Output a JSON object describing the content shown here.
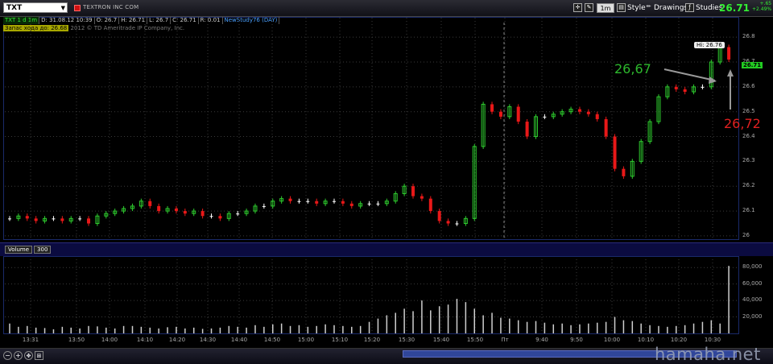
{
  "toolbar": {
    "symbol": "TXT",
    "company": "TEXTRON INC COM",
    "timeframe": "1m",
    "style_label": "Style",
    "drawings_label": "Drawings",
    "studies_label": "Studies",
    "last_price": "26.71",
    "change_line1": "+.65",
    "change_line2": "+2.49%"
  },
  "info": {
    "title": "TXT 1 d 1m",
    "date": "D: 31.08.12 10:39",
    "open": "O: 26.7",
    "high": "H: 26.71",
    "low": "L: 26.7",
    "close": "C: 26.71",
    "range": "R: 0.01",
    "study": "NewStudy76 (DAY)"
  },
  "study_line": {
    "label": "Запас хода до: 26.68",
    "copyright": "2012 © TD Ameritrade IP Company, Inc."
  },
  "hi_label": "Hi: 26.76",
  "last_badge": "26.71",
  "annotations": {
    "left_value": "26,67",
    "right_value": "26,72",
    "left_color": "#2db82d",
    "right_color": "#e02020"
  },
  "price_axis": [
    "26.8",
    "26.7",
    "26.6",
    "26.5",
    "26.4",
    "26.3",
    "26.2",
    "26.1",
    "26"
  ],
  "volume": {
    "label": "Volume",
    "period": "300",
    "axis": [
      "80,000",
      "60,000",
      "40,000",
      "20,000"
    ]
  },
  "time_axis": [
    "13:31",
    "13:50",
    "14:00",
    "14:10",
    "14:20",
    "14:30",
    "14:40",
    "14:50",
    "15:00",
    "15:10",
    "15:20",
    "15:30",
    "15:40",
    "15:50",
    "Пт",
    "9:40",
    "9:50",
    "10:00",
    "10:10",
    "10:20",
    "10:30"
  ],
  "watermark": "hamaha.net",
  "colors": {
    "up": "#2ecc2e",
    "down": "#e81818",
    "unchanged": "#ffffff",
    "grid": "#3a3a3a"
  },
  "chart_data": {
    "type": "candlestick",
    "ylim": [
      25.99,
      26.82
    ],
    "session_break_index": 40,
    "closes": [
      26.07,
      26.08,
      26.07,
      26.06,
      26.07,
      26.07,
      26.06,
      26.07,
      26.07,
      26.05,
      26.08,
      26.09,
      26.1,
      26.11,
      26.12,
      26.14,
      26.12,
      26.1,
      26.11,
      26.1,
      26.09,
      26.1,
      26.08,
      26.08,
      26.07,
      26.09,
      26.09,
      26.1,
      26.12,
      26.12,
      26.14,
      26.15,
      26.14,
      26.14,
      26.14,
      26.13,
      26.14,
      26.14,
      26.13,
      26.12,
      26.13,
      26.13,
      26.13,
      26.14,
      26.17,
      26.2,
      26.16,
      26.15,
      26.1,
      26.06,
      26.05,
      26.05,
      26.07,
      26.36,
      26.53,
      26.5,
      26.48,
      26.52,
      26.46,
      26.4,
      26.48,
      26.48,
      26.49,
      26.5,
      26.51,
      26.5,
      26.49,
      26.47,
      26.4,
      26.27,
      26.24,
      26.3,
      26.38,
      26.46,
      26.56,
      26.6,
      26.59,
      26.58,
      26.6,
      26.6,
      26.7,
      26.76,
      26.71
    ],
    "volumes": [
      12000,
      8000,
      9000,
      7000,
      6500,
      5000,
      8000,
      7000,
      6000,
      9000,
      8500,
      7000,
      6000,
      9000,
      9000,
      8000,
      7000,
      6000,
      7500,
      8000,
      6000,
      7000,
      5500,
      6000,
      7000,
      9000,
      8000,
      7000,
      10000,
      8000,
      11000,
      12000,
      9000,
      10000,
      8000,
      9000,
      11000,
      10000,
      9000,
      8000,
      9000,
      14000,
      18000,
      22000,
      25000,
      30000,
      27000,
      40000,
      28000,
      33000,
      35000,
      42000,
      38000,
      30000,
      22000,
      25000,
      19000,
      18000,
      16000,
      14000,
      15000,
      13000,
      11000,
      12000,
      10000,
      11000,
      12000,
      13000,
      14000,
      20000,
      16000,
      15000,
      12000,
      10000,
      9000,
      8000,
      9000,
      10000,
      12000,
      14000,
      16000,
      12000,
      82000
    ]
  }
}
